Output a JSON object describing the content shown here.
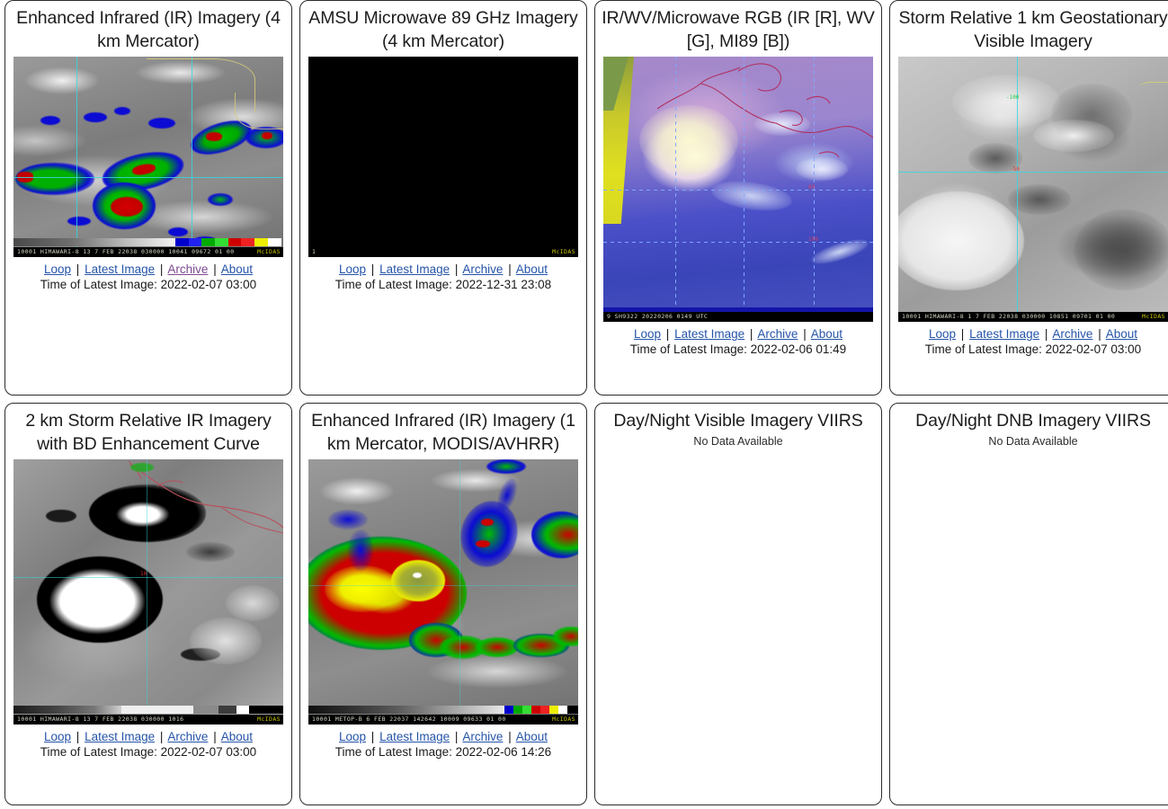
{
  "page": {
    "link_color": "#2554a8",
    "visited_link_color": "#7d4a91",
    "border_color": "#2b2b2b",
    "background": "#ffffff"
  },
  "link_labels": {
    "loop": "Loop",
    "latest_image": "Latest Image",
    "archive": "Archive",
    "about": "About",
    "separator": "|"
  },
  "panels": [
    {
      "id": "enhanced-ir-4km",
      "title": "Enhanced Infrared (IR) Imagery (4 km Mercator)",
      "has_image": true,
      "image_banner": "10001 HIMAWARI-8 13   7 FEB 22038 030000 10041 09672 01 00",
      "image_banner_tail": "McIDAS",
      "timestamp_label": "Time of Latest Image: 2022-02-07 03:00",
      "archive_visited": true,
      "no_data": null
    },
    {
      "id": "amsu-microwave-89ghz",
      "title": "AMSU Microwave 89 GHz Imagery (4 km Mercator)",
      "has_image": true,
      "image_banner": "1",
      "image_banner_tail": "McIDAS",
      "timestamp_label": "Time of Latest Image: 2022-12-31 23:08",
      "archive_visited": false,
      "no_data": null
    },
    {
      "id": "ir-wv-microwave-rgb",
      "title": "IR/WV/Microwave RGB (IR [R], WV [G], MI89 [B])",
      "has_image": true,
      "image_banner": "9      SH9322  20220206  0149 UTC",
      "image_banner_tail": "",
      "timestamp_label": "Time of Latest Image: 2022-02-06 01:49",
      "archive_visited": false,
      "no_data": null
    },
    {
      "id": "storm-relative-1km-visible",
      "title": "Storm Relative 1 km Geostationary Visible Imagery",
      "has_image": true,
      "image_banner": "10001 HIMAWARI-8  1   7 FEB 22038 030000 10851 09701 01 00",
      "image_banner_tail": "McIDAS",
      "timestamp_label": "Time of Latest Image: 2022-02-07 03:00",
      "archive_visited": false,
      "no_data": null
    },
    {
      "id": "storm-relative-2km-ir-bd",
      "title": "2 km Storm Relative IR Imagery with BD Enhancement Curve",
      "has_image": true,
      "image_banner": "10001 HIMAWARI-8 13   7 FEB 22038 030000 1016",
      "image_banner_tail": "McIDAS",
      "timestamp_label": "Time of Latest Image: 2022-02-07 03:00",
      "archive_visited": false,
      "no_data": null
    },
    {
      "id": "enhanced-ir-1km-modis-avhrr",
      "title": "Enhanced Infrared (IR) Imagery (1 km Mercator, MODIS/AVHRR)",
      "has_image": true,
      "image_banner": "10001 METOP-B     6 FEB 22037 142642 10009 09633 01 00",
      "image_banner_tail": "McIDAS",
      "timestamp_label": "Time of Latest Image: 2022-02-06 14:26",
      "archive_visited": false,
      "no_data": null
    },
    {
      "id": "day-night-visible-viirs",
      "title": "Day/Night Visible Imagery VIIRS",
      "has_image": false,
      "image_banner": null,
      "image_banner_tail": null,
      "timestamp_label": null,
      "archive_visited": false,
      "no_data": "No Data Available"
    },
    {
      "id": "day-night-dnb-viirs",
      "title": "Day/Night DNB Imagery VIIRS",
      "has_image": false,
      "image_banner": null,
      "image_banner_tail": null,
      "timestamp_label": null,
      "archive_visited": false,
      "no_data": "No Data Available"
    }
  ],
  "colorbar_stops": [
    "#0000cc",
    "#2222ee",
    "#00aa00",
    "#33dd33",
    "#cc0000",
    "#ee2222",
    "#eeee00",
    "#ffffff",
    "#dddddd",
    "#000066"
  ]
}
